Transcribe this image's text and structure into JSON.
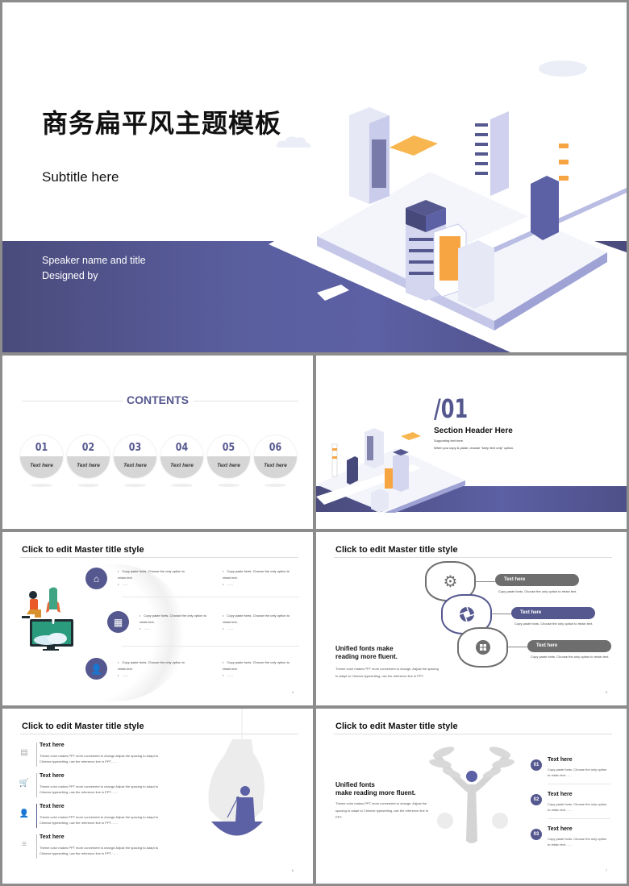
{
  "colors": {
    "accent": "#55588f",
    "band": "#5c60a4",
    "grey": "#6e6e6e",
    "orange": "#f7a443"
  },
  "slide1": {
    "title": "商务扁平风主题模板",
    "subtitle": "Subtitle here",
    "speaker": "Speaker name and title",
    "designed_by": "Designed by"
  },
  "slide2": {
    "title": "CONTENTS",
    "items": [
      {
        "num": "01",
        "label": "Text here"
      },
      {
        "num": "02",
        "label": "Text here"
      },
      {
        "num": "03",
        "label": "Text here"
      },
      {
        "num": "04",
        "label": "Text here"
      },
      {
        "num": "05",
        "label": "Text here"
      },
      {
        "num": "06",
        "label": "Text here"
      }
    ]
  },
  "slide3": {
    "number": "/01",
    "header": "Section Header Here",
    "supporting": "Supporting text here.",
    "note": "When you copy & paste, choose \"keep text only\" option."
  },
  "slide4": {
    "title": "Click to edit Master title style",
    "rows": [
      {
        "icon": "home-icon",
        "col1": "Copy paste fonts. Choose the only option to retain text.",
        "col1_b": "……",
        "col2": "Copy paste fonts. Choose the only option to retain text.",
        "col2_b": "……"
      },
      {
        "icon": "building-icon",
        "col1": "Copy paste fonts. Choose the only option to retain text.",
        "col1_b": "……",
        "col2": "Copy paste fonts. Choose the only option to retain text.",
        "col2_b": "……"
      },
      {
        "icon": "users-icon",
        "col1": "Copy paste fonts. Choose the only option to retain text.",
        "col1_b": "……",
        "col2": "Copy paste fonts. Choose the only option to retain text.",
        "col2_b": "……"
      }
    ],
    "page": "4"
  },
  "slide5": {
    "title": "Click to edit Master title style",
    "items": [
      {
        "icon": "gear-icon",
        "label": "Text here",
        "desc": "Copy paste fonts. Choose the only option to retain text."
      },
      {
        "icon": "aperture-icon",
        "label": "Text here",
        "desc": "Copy paste fonts. Choose the only option to retain text."
      },
      {
        "icon": "windows-icon",
        "label": "Text here",
        "desc": "Copy paste fonts. Choose the only option to retain text."
      }
    ],
    "heading_line1": "Unified fonts make",
    "heading_line2": "reading more fluent.",
    "body": "Theme color makes PPT more convenient to change. Adjust the spacing to adapt to Chinese typesetting, use the reference line in PPT.",
    "page": "5"
  },
  "slide6": {
    "title": "Click to edit Master title style",
    "items": [
      {
        "icon": "wallet-icon",
        "heading": "Text here",
        "body": "Theme color makes PPT more convenient to change.Adjust the spacing to adapt to Chinese typesetting, use the reference line in PPT……"
      },
      {
        "icon": "cart-icon",
        "heading": "Text here",
        "body": "Theme color makes PPT more convenient to change.Adjust the spacing to adapt to Chinese typesetting, use the reference line in PPT……"
      },
      {
        "icon": "user-settings-icon",
        "heading": "Text here",
        "body": "Theme color makes PPT more convenient to change.Adjust the spacing to adapt to Chinese typesetting, use the reference line in PPT……"
      },
      {
        "icon": "money-hand-icon",
        "heading": "Text here",
        "body": "Theme color makes PPT more convenient to change.Adjust the spacing to adapt to Chinese typesetting, use the reference line in PPT……"
      }
    ],
    "page": "6"
  },
  "slide7": {
    "title": "Click to edit Master title style",
    "heading_line1": "Unified fonts",
    "heading_line2": "make reading more fluent.",
    "body": "Theme color makes PPT more convenient to change. Adjust the spacing to adapt to Chinese typesetting, use the reference line in PPT.",
    "items": [
      {
        "num": "01",
        "heading": "Text here",
        "body": "Copy paste fonts. Choose the only option to retain text……"
      },
      {
        "num": "02",
        "heading": "Text here",
        "body": "Copy paste fonts. Choose the only option to retain text……"
      },
      {
        "num": "03",
        "heading": "Text here",
        "body": "Copy paste fonts. Choose the only option to retain text……"
      }
    ],
    "page": "7"
  }
}
